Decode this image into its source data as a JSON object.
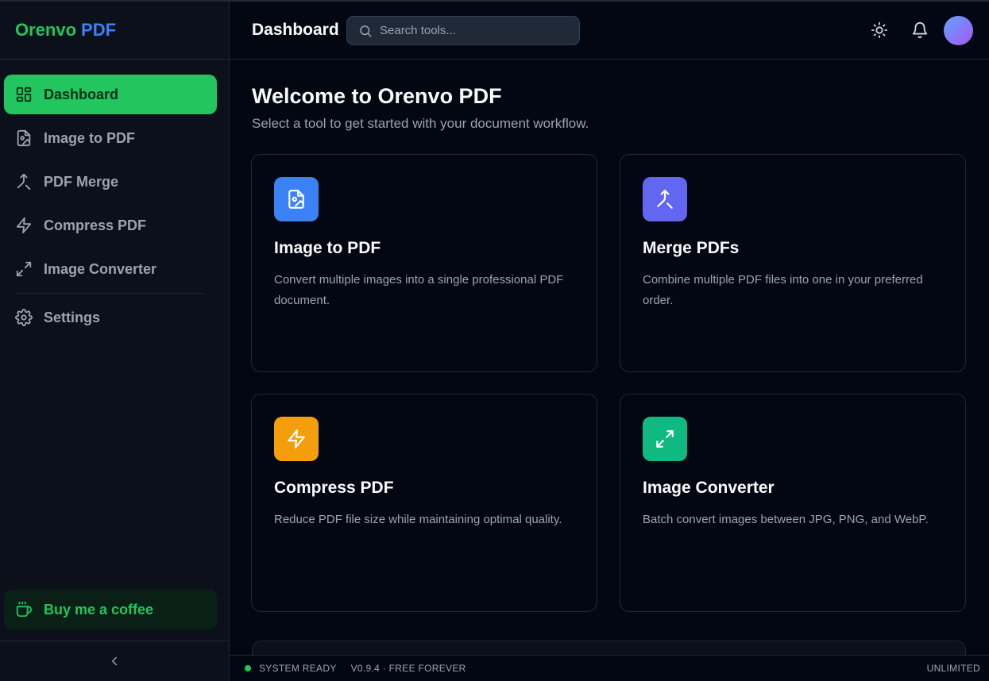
{
  "brand": {
    "part1": "Orenvo",
    "part2": "PDF"
  },
  "sidebar": {
    "items": [
      {
        "label": "Dashboard",
        "icon": "layout-grid-icon",
        "active": true
      },
      {
        "label": "Image to PDF",
        "icon": "file-image-icon"
      },
      {
        "label": "PDF Merge",
        "icon": "merge-icon"
      },
      {
        "label": "Compress PDF",
        "icon": "zap-icon"
      },
      {
        "label": "Image Converter",
        "icon": "expand-icon"
      }
    ],
    "settings": {
      "label": "Settings",
      "icon": "gear-icon"
    },
    "coffee": {
      "label": "Buy me a coffee",
      "icon": "coffee-icon"
    },
    "collapse_icon": "chevron-left-icon"
  },
  "header": {
    "title": "Dashboard",
    "search_placeholder": "Search tools...",
    "theme_icon": "sun-icon",
    "bell_icon": "bell-icon"
  },
  "main": {
    "welcome": "Welcome to Orenvo PDF",
    "subtitle": "Select a tool to get started with your document workflow.",
    "cards": [
      {
        "title": "Image to PDF",
        "desc": "Convert multiple images into a single professional PDF document.",
        "icon": "file-image-icon",
        "color": "#3b82f6"
      },
      {
        "title": "Merge PDFs",
        "desc": "Combine multiple PDF files into one in your preferred order.",
        "icon": "merge-icon",
        "color": "#6366f1"
      },
      {
        "title": "Compress PDF",
        "desc": "Reduce PDF file size while maintaining optimal quality.",
        "icon": "zap-icon",
        "color": "#f59e0b"
      },
      {
        "title": "Image Converter",
        "desc": "Batch convert images between JPG, PNG, and WebP.",
        "icon": "expand-icon",
        "color": "#10b981"
      }
    ]
  },
  "status": {
    "ready": "SYSTEM READY",
    "version": "V0.9.4 · FREE FOREVER",
    "plan": "UNLIMITED"
  },
  "colors": {
    "accent": "#22c55e",
    "brand_blue": "#3b82f6",
    "background": "#030712"
  }
}
